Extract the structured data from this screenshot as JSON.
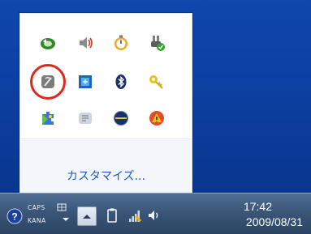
{
  "tray_popup": {
    "icons": [
      [
        "sync-icon",
        "volume-icon",
        "stopwatch-icon",
        "device-check-icon"
      ],
      [
        "network-disconnected-icon",
        "display-icon",
        "bluetooth-icon",
        "key-icon"
      ],
      [
        "puzzle-icon",
        "shield-app-icon",
        "media-icon",
        "warning-icon"
      ]
    ],
    "customize_label": "カスタマイズ..."
  },
  "taskbar": {
    "ime_caps": "CAPS",
    "ime_kana": "KANA",
    "clock_time": "17:42",
    "clock_date": "2009/08/31"
  },
  "colors": {
    "desktop": "#0b3da0",
    "highlight_ring": "#e0281b",
    "link": "#1c57b8"
  }
}
